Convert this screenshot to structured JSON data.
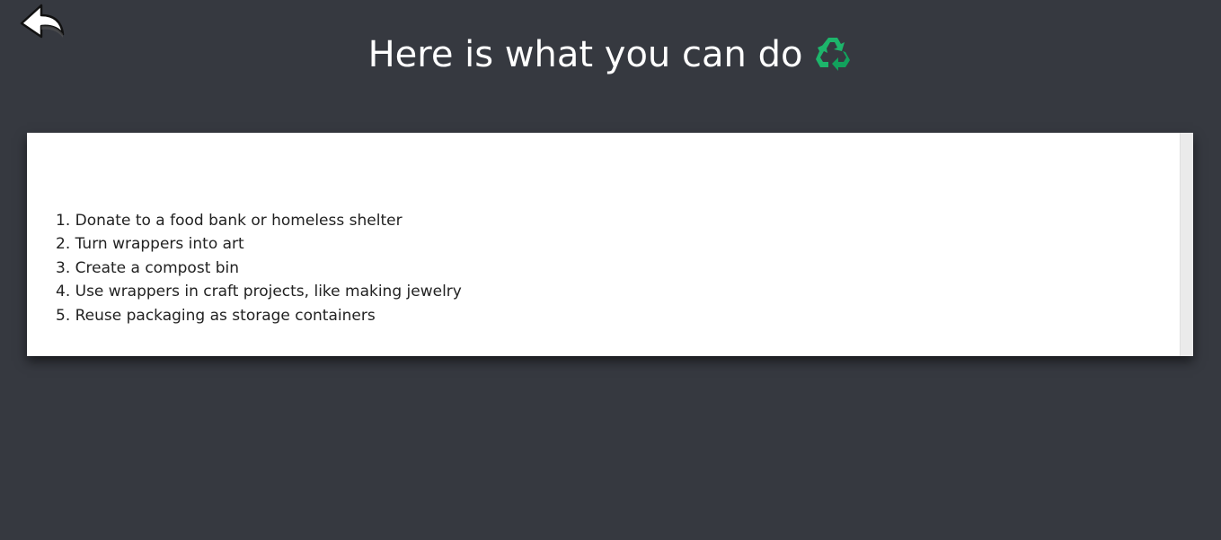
{
  "header": {
    "title": "Here is what you can do",
    "back_icon": "back-arrow-icon",
    "title_icon": "recycle-icon",
    "recycle_color": "#1db56b"
  },
  "suggestions": [
    "1. Donate to a food bank or homeless shelter",
    "2. Turn wrappers into art",
    "3. Create a compost bin",
    "4. Use wrappers in craft projects, like making jewelry",
    "5. Reuse packaging as storage containers"
  ],
  "colors": {
    "background": "#363940",
    "card": "#ffffff",
    "title_text": "#ffffff",
    "body_text": "#222222"
  }
}
